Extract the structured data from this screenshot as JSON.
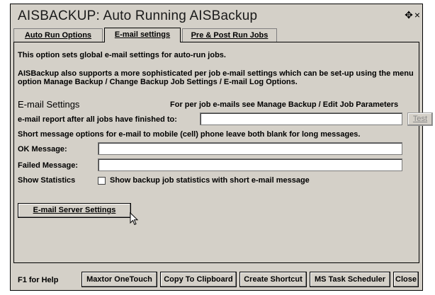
{
  "window": {
    "title": "AISBACKUP: Auto Running AISBackup",
    "move_glyph": "✥",
    "close_glyph": "×"
  },
  "tabs": [
    {
      "label": "Auto Run Options",
      "active": false
    },
    {
      "label": "E-mail settings",
      "active": true
    },
    {
      "label": "Pre & Post Run Jobs",
      "active": false
    }
  ],
  "panel": {
    "intro_line1": "This option sets global e-mail settings for auto-run jobs.",
    "intro_line2": "AISBackup also supports a more sophisticated per job e-mail settings which can be set-up using the menu",
    "intro_line3": "option Manage Backup / Change Backup Job Settings / E-mail Log Options.",
    "section_title": "E-mail Settings",
    "per_job_note": "For per job e-mails see Manage Backup / Edit Job Parameters",
    "email_report_label": "e-mail report after all jobs have finished to:",
    "email_report_value": "",
    "test_button": "Test",
    "short_msg_note": "Short message options for e-mail to mobile (cell) phone leave both blank for long messages.",
    "ok_message_label": "OK Message:",
    "ok_message_value": "",
    "failed_message_label": "Failed Message:",
    "failed_message_value": "",
    "show_stats_label": "Show Statistics",
    "show_stats_checkbox_label": "Show backup job statistics with short e-mail message",
    "show_stats_checked": false,
    "server_settings_button": "E-mail Server Settings"
  },
  "bottom": {
    "help_text": "F1 for Help",
    "buttons": [
      "Maxtor OneTouch",
      "Copy To Clipboard",
      "Create Shortcut",
      "MS Task Scheduler",
      "Close"
    ]
  }
}
